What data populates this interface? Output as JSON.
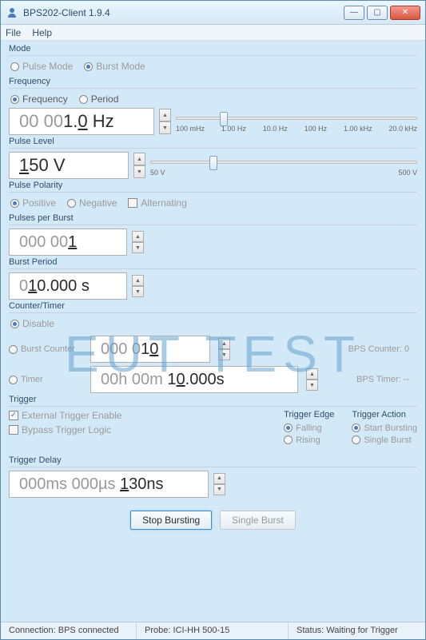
{
  "window": {
    "title": "BPS202-Client 1.9.4"
  },
  "menu": {
    "file": "File",
    "help": "Help"
  },
  "mode": {
    "title": "Mode",
    "pulse": "Pulse Mode",
    "burst": "Burst Mode",
    "selected": "burst"
  },
  "frequency": {
    "title": "Frequency",
    "freq_label": "Frequency",
    "period_label": "Period",
    "selected": "frequency",
    "value_grey": "00 00",
    "value_dark": "1.0 Hz",
    "ticks": [
      "100 mHz",
      "1.00 Hz",
      "10.0 Hz",
      "100 Hz",
      "1.00 kHz",
      "20.0 kHz"
    ]
  },
  "pulse_level": {
    "title": "Pulse Level",
    "value": "150 V",
    "min": "50 V",
    "max": "500 V"
  },
  "polarity": {
    "title": "Pulse Polarity",
    "positive": "Positive",
    "negative": "Negative",
    "alternating": "Alternating"
  },
  "pulses_per_burst": {
    "title": "Pulses per Burst",
    "value_grey": "000 00",
    "value_dark": "1"
  },
  "burst_period": {
    "title": "Burst Period",
    "value_grey": "0",
    "value_dark": "10.000 s"
  },
  "counter": {
    "title": "Counter/Timer",
    "disable": "Disable",
    "burst_counter": "Burst Counter",
    "timer": "Timer",
    "counter_grey": "000 0",
    "counter_dark": "10",
    "bps_counter_label": "BPS Counter: 0",
    "timer_grey": "00h 00m ",
    "timer_dark": "10.000s",
    "bps_timer_label": "BPS Timer: --"
  },
  "trigger": {
    "title": "Trigger",
    "ext_enable": "External Trigger Enable",
    "bypass": "Bypass Trigger Logic",
    "edge_title": "Trigger Edge",
    "falling": "Falling",
    "rising": "Rising",
    "action_title": "Trigger Action",
    "start_bursting": "Start Bursting",
    "single_burst": "Single Burst",
    "delay_title": "Trigger Delay",
    "delay_grey1": "000ms 000µs ",
    "delay_dark": "130ns"
  },
  "buttons": {
    "stop": "Stop Bursting",
    "single": "Single Burst"
  },
  "status": {
    "connection": "Connection: BPS connected",
    "probe": "Probe: ICI-HH 500-15",
    "status": "Status: Waiting for Trigger"
  },
  "watermark": "EUT TEST"
}
